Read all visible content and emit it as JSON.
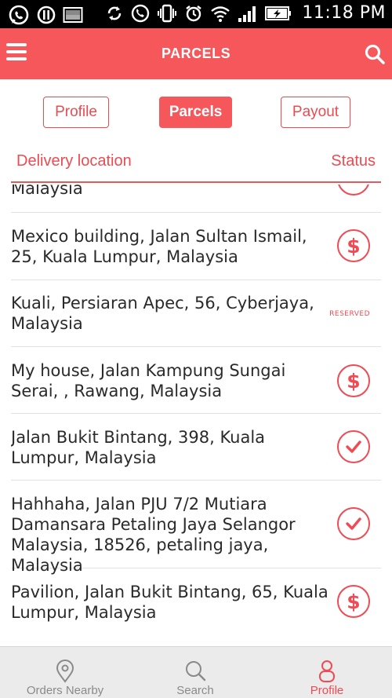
{
  "status_bar": {
    "time": "11:18 PM",
    "icons": [
      "whatsapp-icon",
      "pause-circle-icon",
      "image-icon",
      "sync-icon",
      "call-forward-icon",
      "vibrate-icon",
      "alarm-icon",
      "wifi-icon",
      "signal-icon",
      "battery-charging-icon"
    ]
  },
  "app_bar": {
    "title": "PARCELS",
    "menu_icon": "hamburger-menu-icon",
    "search_icon": "search-icon",
    "color": "#f6575b"
  },
  "tabs": [
    {
      "label": "Profile",
      "active": false
    },
    {
      "label": "Parcels",
      "active": true
    },
    {
      "label": "Payout",
      "active": false
    }
  ],
  "columns": {
    "location": "Delivery location",
    "status": "Status"
  },
  "rows": [
    {
      "address": "Malaysia",
      "status": "partial"
    },
    {
      "address": "Mexico building,  Jalan Sultan Ismail, 25, Kuala Lumpur, Malaysia",
      "status": "dollar",
      "icon": "dollar-icon"
    },
    {
      "address": "Kuali, Persiaran Apec, 56, Cyberjaya, Malaysia",
      "status": "reserved",
      "status_text": "RESERVED"
    },
    {
      "address": "My house, Jalan Kampung Sungai Serai, , Rawang, Malaysia",
      "status": "dollar",
      "icon": "dollar-icon"
    },
    {
      "address": " Jalan Bukit Bintang, 398, Kuala Lumpur, Malaysia",
      "status": "check",
      "icon": "check-icon"
    },
    {
      "address": "Hahhaha, Jalan PJU 7/2 Mutiara Damansara Petaling Jaya Selangor Malaysia, 18526, petaling jaya, Malaysia",
      "status": "check",
      "icon": "check-icon"
    },
    {
      "address": "Pavilion,  Jalan Bukit Bintang, 65, Kuala Lumpur, Malaysia",
      "status": "dollar",
      "icon": "dollar-icon"
    }
  ],
  "bottom_nav": [
    {
      "label": "Orders Nearby",
      "icon": "location-pin-icon",
      "active": false
    },
    {
      "label": "Search",
      "icon": "search-icon",
      "active": false
    },
    {
      "label": "Profile",
      "icon": "person-icon",
      "active": true
    }
  ],
  "colors": {
    "accent": "#f6575b",
    "status_red": "#ef4b55",
    "inactive_gray": "#8a8a8a"
  }
}
